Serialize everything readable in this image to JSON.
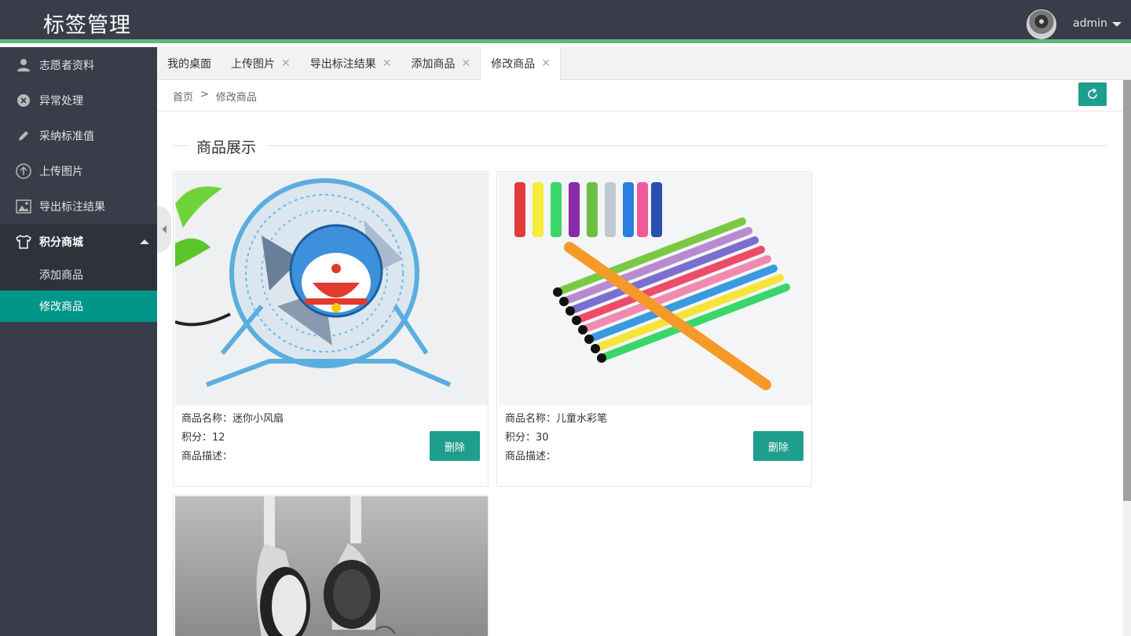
{
  "app": {
    "title": "标签管理",
    "user": "admin"
  },
  "sidebar": {
    "items": [
      {
        "label": "志愿者资料",
        "icon": "user-icon"
      },
      {
        "label": "异常处理",
        "icon": "circle-x-icon"
      },
      {
        "label": "采纳标准值",
        "icon": "pencil-icon"
      },
      {
        "label": "上传图片",
        "icon": "upload-icon"
      },
      {
        "label": "导出标注结果",
        "icon": "image-icon"
      }
    ],
    "group": {
      "label": "积分商城",
      "icon": "shirt-icon",
      "children": [
        {
          "label": "添加商品"
        },
        {
          "label": "修改商品"
        }
      ]
    }
  },
  "tabs": [
    {
      "label": "我的桌面"
    },
    {
      "label": "上传图片"
    },
    {
      "label": "导出标注结果"
    },
    {
      "label": "添加商品"
    },
    {
      "label": "修改商品"
    }
  ],
  "breadcrumb": {
    "home": "首页",
    "sep": ">",
    "current": "修改商品"
  },
  "section": {
    "title": "商品展示"
  },
  "products": [
    {
      "name_label": "商品名称：迷你小风扇",
      "points_label": "积分：12",
      "desc_label": "商品描述：",
      "delete_label": "删除"
    },
    {
      "name_label": "商品名称：儿童水彩笔",
      "points_label": "积分：30",
      "desc_label": "商品描述：",
      "delete_label": "删除"
    }
  ],
  "colors": {
    "header": "#393d49",
    "accent": "#009688",
    "header_line": "#5fb878"
  }
}
